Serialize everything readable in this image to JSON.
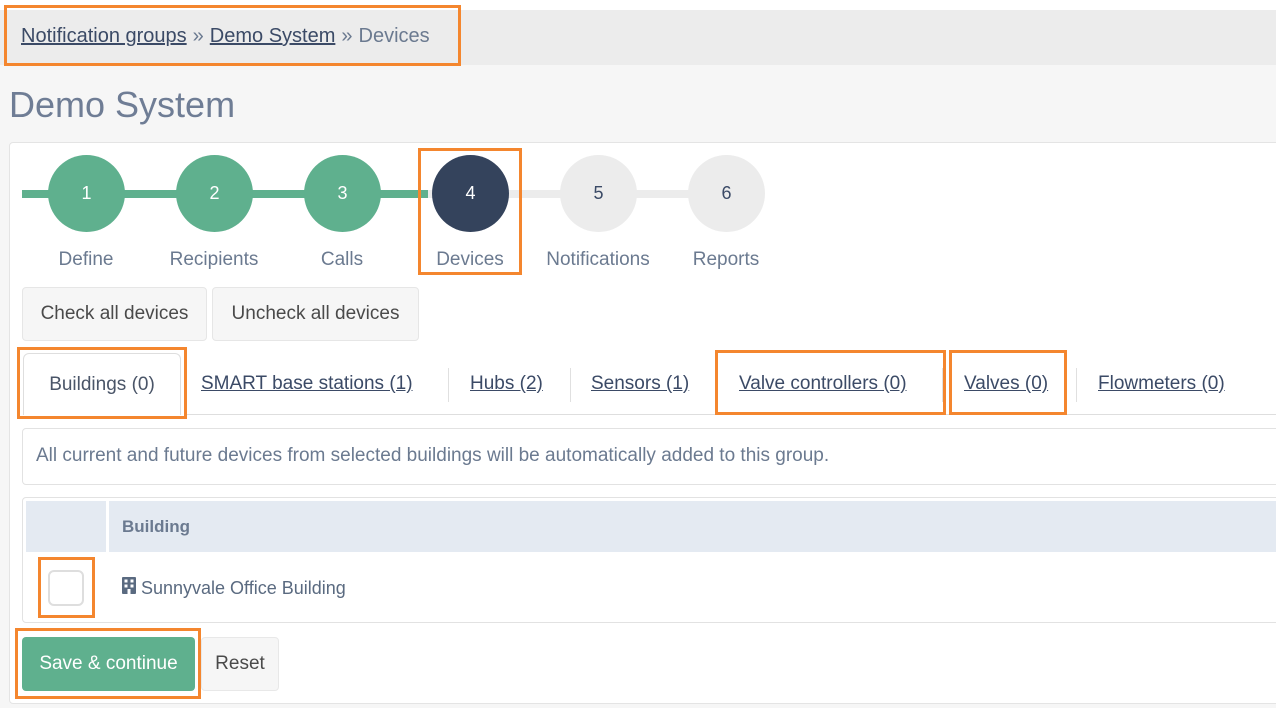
{
  "breadcrumb": {
    "items": [
      {
        "label": "Notification groups"
      },
      {
        "label": "Demo System"
      },
      {
        "label": "Devices"
      }
    ],
    "separator": "»"
  },
  "page": {
    "title": "Demo System"
  },
  "steps": [
    {
      "number": "1",
      "label": "Define",
      "state": "done"
    },
    {
      "number": "2",
      "label": "Recipients",
      "state": "done"
    },
    {
      "number": "3",
      "label": "Calls",
      "state": "done"
    },
    {
      "number": "4",
      "label": "Devices",
      "state": "active"
    },
    {
      "number": "5",
      "label": "Notifications",
      "state": "todo"
    },
    {
      "number": "6",
      "label": "Reports",
      "state": "todo"
    }
  ],
  "actions": {
    "check_all": "Check all devices",
    "uncheck_all": "Uncheck all devices"
  },
  "tabs": [
    {
      "label": "Buildings (0)"
    },
    {
      "label": "SMART base stations (1)"
    },
    {
      "label": "Hubs (2)"
    },
    {
      "label": "Sensors (1)"
    },
    {
      "label": "Valve controllers (0)"
    },
    {
      "label": "Valves (0)"
    },
    {
      "label": "Flowmeters (0)"
    }
  ],
  "info_text": "All current and future devices from selected buildings will be automatically added to this group.",
  "table": {
    "header": "Building",
    "rows": [
      {
        "name": "Sunnyvale Office Building",
        "checked": false
      }
    ]
  },
  "buttons": {
    "save": "Save & continue",
    "reset": "Reset"
  },
  "colors": {
    "accent_green": "#5fb08e",
    "active_step": "#34435c",
    "highlight": "#f4862e"
  },
  "icons": {
    "building": "building-icon"
  }
}
